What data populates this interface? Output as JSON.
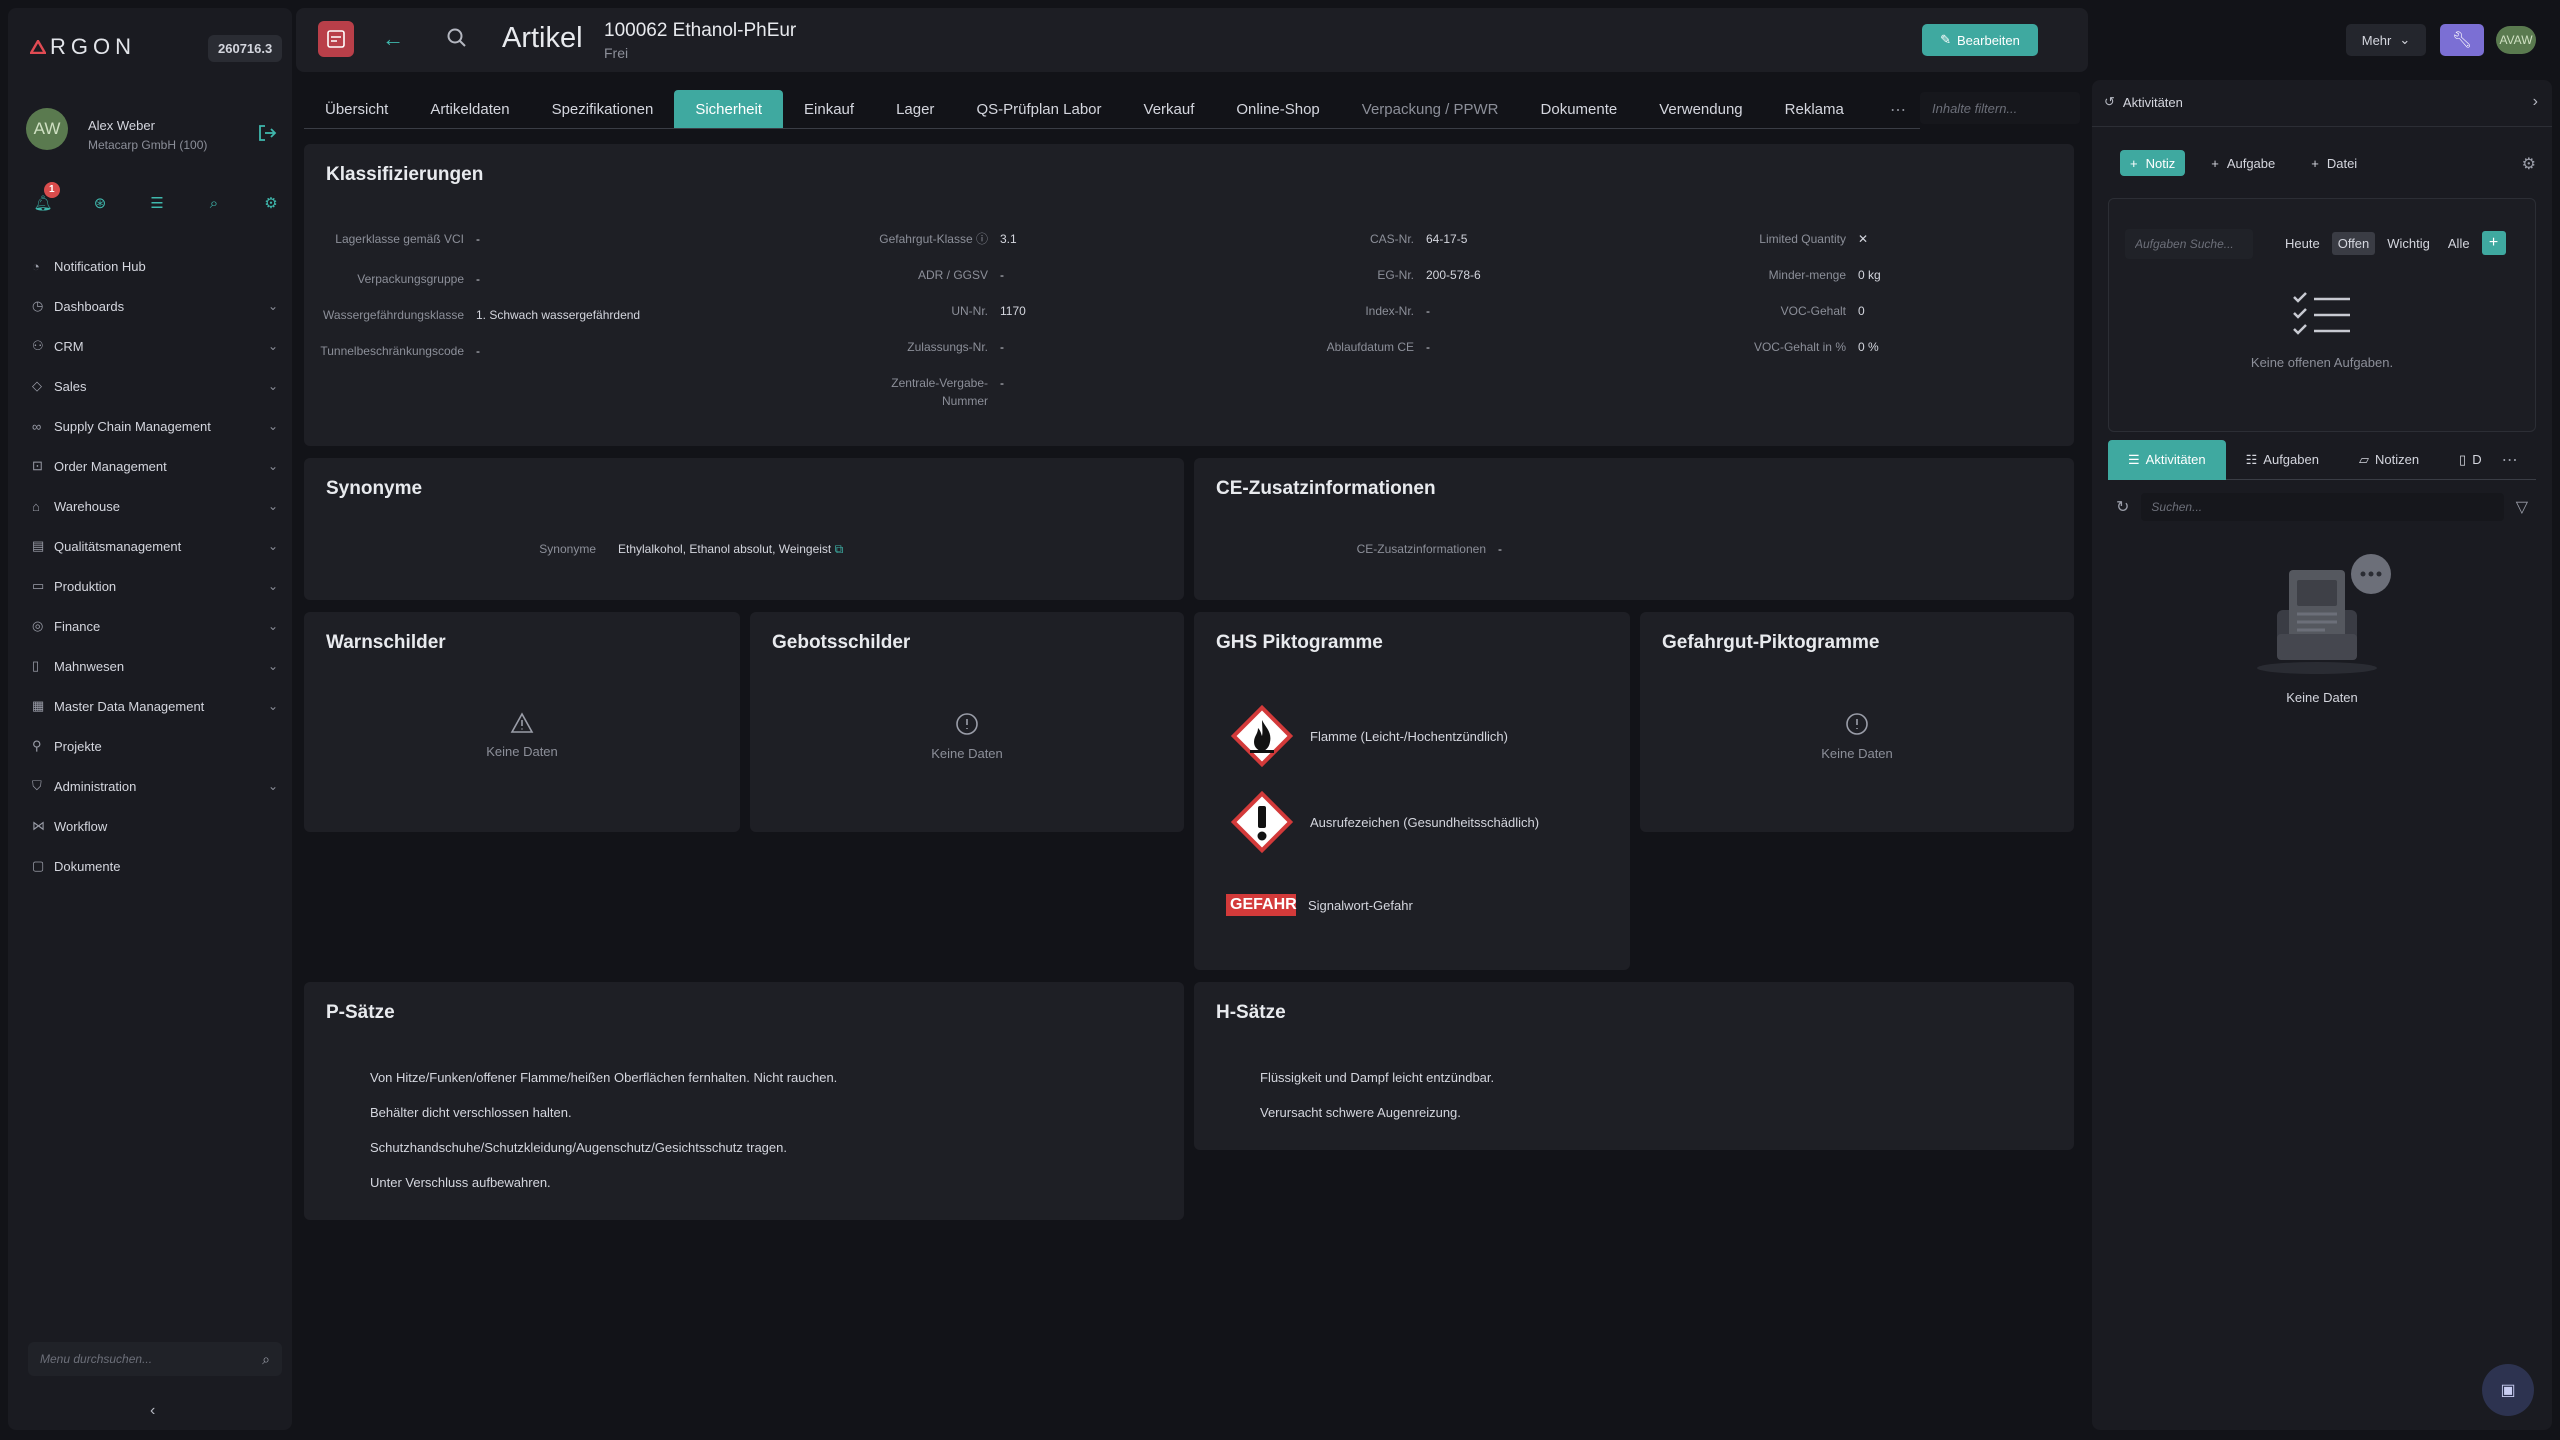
{
  "sidebar": {
    "logo": "RGON",
    "version": "260716.3",
    "user": {
      "initials": "AW",
      "name": "Alex Weber",
      "company": "Metacarp GmbH (100)"
    },
    "notifications": "1",
    "items": [
      {
        "label": "Notification Hub",
        "icon": "bell-icon",
        "expandable": false
      },
      {
        "label": "Dashboards",
        "icon": "dashboard-icon",
        "expandable": true
      },
      {
        "label": "CRM",
        "icon": "users-icon",
        "expandable": true
      },
      {
        "label": "Sales",
        "icon": "tag-icon",
        "expandable": true
      },
      {
        "label": "Supply Chain Management",
        "icon": "link-icon",
        "expandable": true
      },
      {
        "label": "Order Management",
        "icon": "cart-icon",
        "expandable": true
      },
      {
        "label": "Warehouse",
        "icon": "warehouse-icon",
        "expandable": true
      },
      {
        "label": "Qualitätsmanagement",
        "icon": "clipboard-icon",
        "expandable": true
      },
      {
        "label": "Produktion",
        "icon": "folder-icon",
        "expandable": true
      },
      {
        "label": "Finance",
        "icon": "finance-icon",
        "expandable": true
      },
      {
        "label": "Mahnwesen",
        "icon": "document-icon",
        "expandable": true
      },
      {
        "label": "Master Data Management",
        "icon": "database-icon",
        "expandable": true
      },
      {
        "label": "Projekte",
        "icon": "pin-icon",
        "expandable": false
      },
      {
        "label": "Administration",
        "icon": "shield-icon",
        "expandable": true
      },
      {
        "label": "Workflow",
        "icon": "workflow-icon",
        "expandable": false
      },
      {
        "label": "Dokumente",
        "icon": "file-icon",
        "expandable": false
      }
    ],
    "search_placeholder": "Menu durchsuchen..."
  },
  "header": {
    "title": "Artikel",
    "article": "100062 Ethanol-PhEur",
    "status": "Frei",
    "edit_label": "Bearbeiten",
    "more_label": "Mehr",
    "user_initials": "AVAW"
  },
  "tabs": [
    {
      "label": "Übersicht",
      "active": false,
      "dim": false
    },
    {
      "label": "Artikeldaten",
      "active": false,
      "dim": false
    },
    {
      "label": "Spezifikationen",
      "active": false,
      "dim": false
    },
    {
      "label": "Sicherheit",
      "active": true,
      "dim": false
    },
    {
      "label": "Einkauf",
      "active": false,
      "dim": false
    },
    {
      "label": "Lager",
      "active": false,
      "dim": false
    },
    {
      "label": "QS-Prüfplan Labor",
      "active": false,
      "dim": false
    },
    {
      "label": "Verkauf",
      "active": false,
      "dim": false
    },
    {
      "label": "Online-Shop",
      "active": false,
      "dim": false
    },
    {
      "label": "Verpackung / PPWR",
      "active": false,
      "dim": true
    },
    {
      "label": "Dokumente",
      "active": false,
      "dim": false
    },
    {
      "label": "Verwendung",
      "active": false,
      "dim": false
    },
    {
      "label": "Reklama",
      "active": false,
      "dim": false
    }
  ],
  "tab_filter_placeholder": "Inhalte filtern...",
  "klass": {
    "title": "Klassifizierungen",
    "col1": [
      {
        "k": "Lagerklasse gemäß VCI",
        "v": "-"
      },
      {
        "k": "Verpackungsgruppe",
        "v": "-"
      },
      {
        "k": "Wassergefährdungsklasse",
        "v": "1. Schwach wassergefährdend"
      },
      {
        "k": "Tunnelbeschränkungscode",
        "v": "-"
      }
    ],
    "col2": [
      {
        "k": "Gefahrgut-Klasse",
        "v": "3.1"
      },
      {
        "k": "ADR / GGSV",
        "v": "-"
      },
      {
        "k": "UN-Nr.",
        "v": "1170"
      },
      {
        "k": "Zulassungs-Nr.",
        "v": "-"
      },
      {
        "k": "Zentrale-Vergabe-Nummer",
        "v": "-"
      }
    ],
    "col3": [
      {
        "k": "CAS-Nr.",
        "v": "64-17-5"
      },
      {
        "k": "EG-Nr.",
        "v": "200-578-6"
      },
      {
        "k": "Index-Nr.",
        "v": "-"
      },
      {
        "k": "Ablaufdatum CE",
        "v": "-"
      }
    ],
    "col4": [
      {
        "k": "Limited Quantity",
        "v": "✕"
      },
      {
        "k": "Minder-menge",
        "v": "0 kg"
      },
      {
        "k": "VOC-Gehalt",
        "v": "0"
      },
      {
        "k": "VOC-Gehalt in %",
        "v": "0 %"
      }
    ]
  },
  "synonyme": {
    "title": "Synonyme",
    "key": "Synonyme",
    "value": "Ethylalkohol, Ethanol absolut, Weingeist"
  },
  "ce": {
    "title": "CE-Zusatzinformationen",
    "key": "CE-Zusatzinformationen",
    "value": "-"
  },
  "warn": {
    "title": "Warnschilder",
    "empty": "Keine Daten"
  },
  "gebot": {
    "title": "Gebotsschilder",
    "empty": "Keine Daten"
  },
  "ghs": {
    "title": "GHS Piktogramme",
    "items": [
      {
        "label": "Flamme (Leicht-/Hochentzündlich)"
      },
      {
        "label": "Ausrufezeichen (Gesundheitsschädlich)"
      },
      {
        "label": "Signalwort-Gefahr",
        "signal": "GEFAHR"
      }
    ]
  },
  "gefahrgut": {
    "title": "Gefahrgut-Piktogramme",
    "empty": "Keine Daten"
  },
  "psaetze": {
    "title": "P-Sätze",
    "items": [
      "Von Hitze/Funken/offener Flamme/heißen Oberflächen fernhalten. Nicht rauchen.",
      "Behälter dicht verschlossen halten.",
      "Schutzhandschuhe/Schutzkleidung/Augenschutz/Gesichtsschutz tragen.",
      "Unter Verschluss aufbewahren."
    ]
  },
  "hsaetze": {
    "title": "H-Sätze",
    "items": [
      "Flüssigkeit und Dampf leicht entzündbar.",
      "Verursacht schwere Augenreizung."
    ]
  },
  "panel": {
    "title": "Aktivitäten",
    "btn_notiz": "Notiz",
    "btn_aufgabe": "Aufgabe",
    "btn_datei": "Datei",
    "task_search_placeholder": "Aufgaben Suche...",
    "filters": [
      "Heute",
      "Offen",
      "Wichtig",
      "Alle"
    ],
    "active_filter": "Offen",
    "no_tasks": "Keine offenen Aufgaben.",
    "tabs": [
      "Aktivitäten",
      "Aufgaben",
      "Notizen",
      "D"
    ],
    "search_placeholder": "Suchen...",
    "no_data": "Keine Daten"
  },
  "colors": {
    "accent": "#3fa9a0",
    "danger": "#d33a3a",
    "purple": "#7b6fd4"
  }
}
